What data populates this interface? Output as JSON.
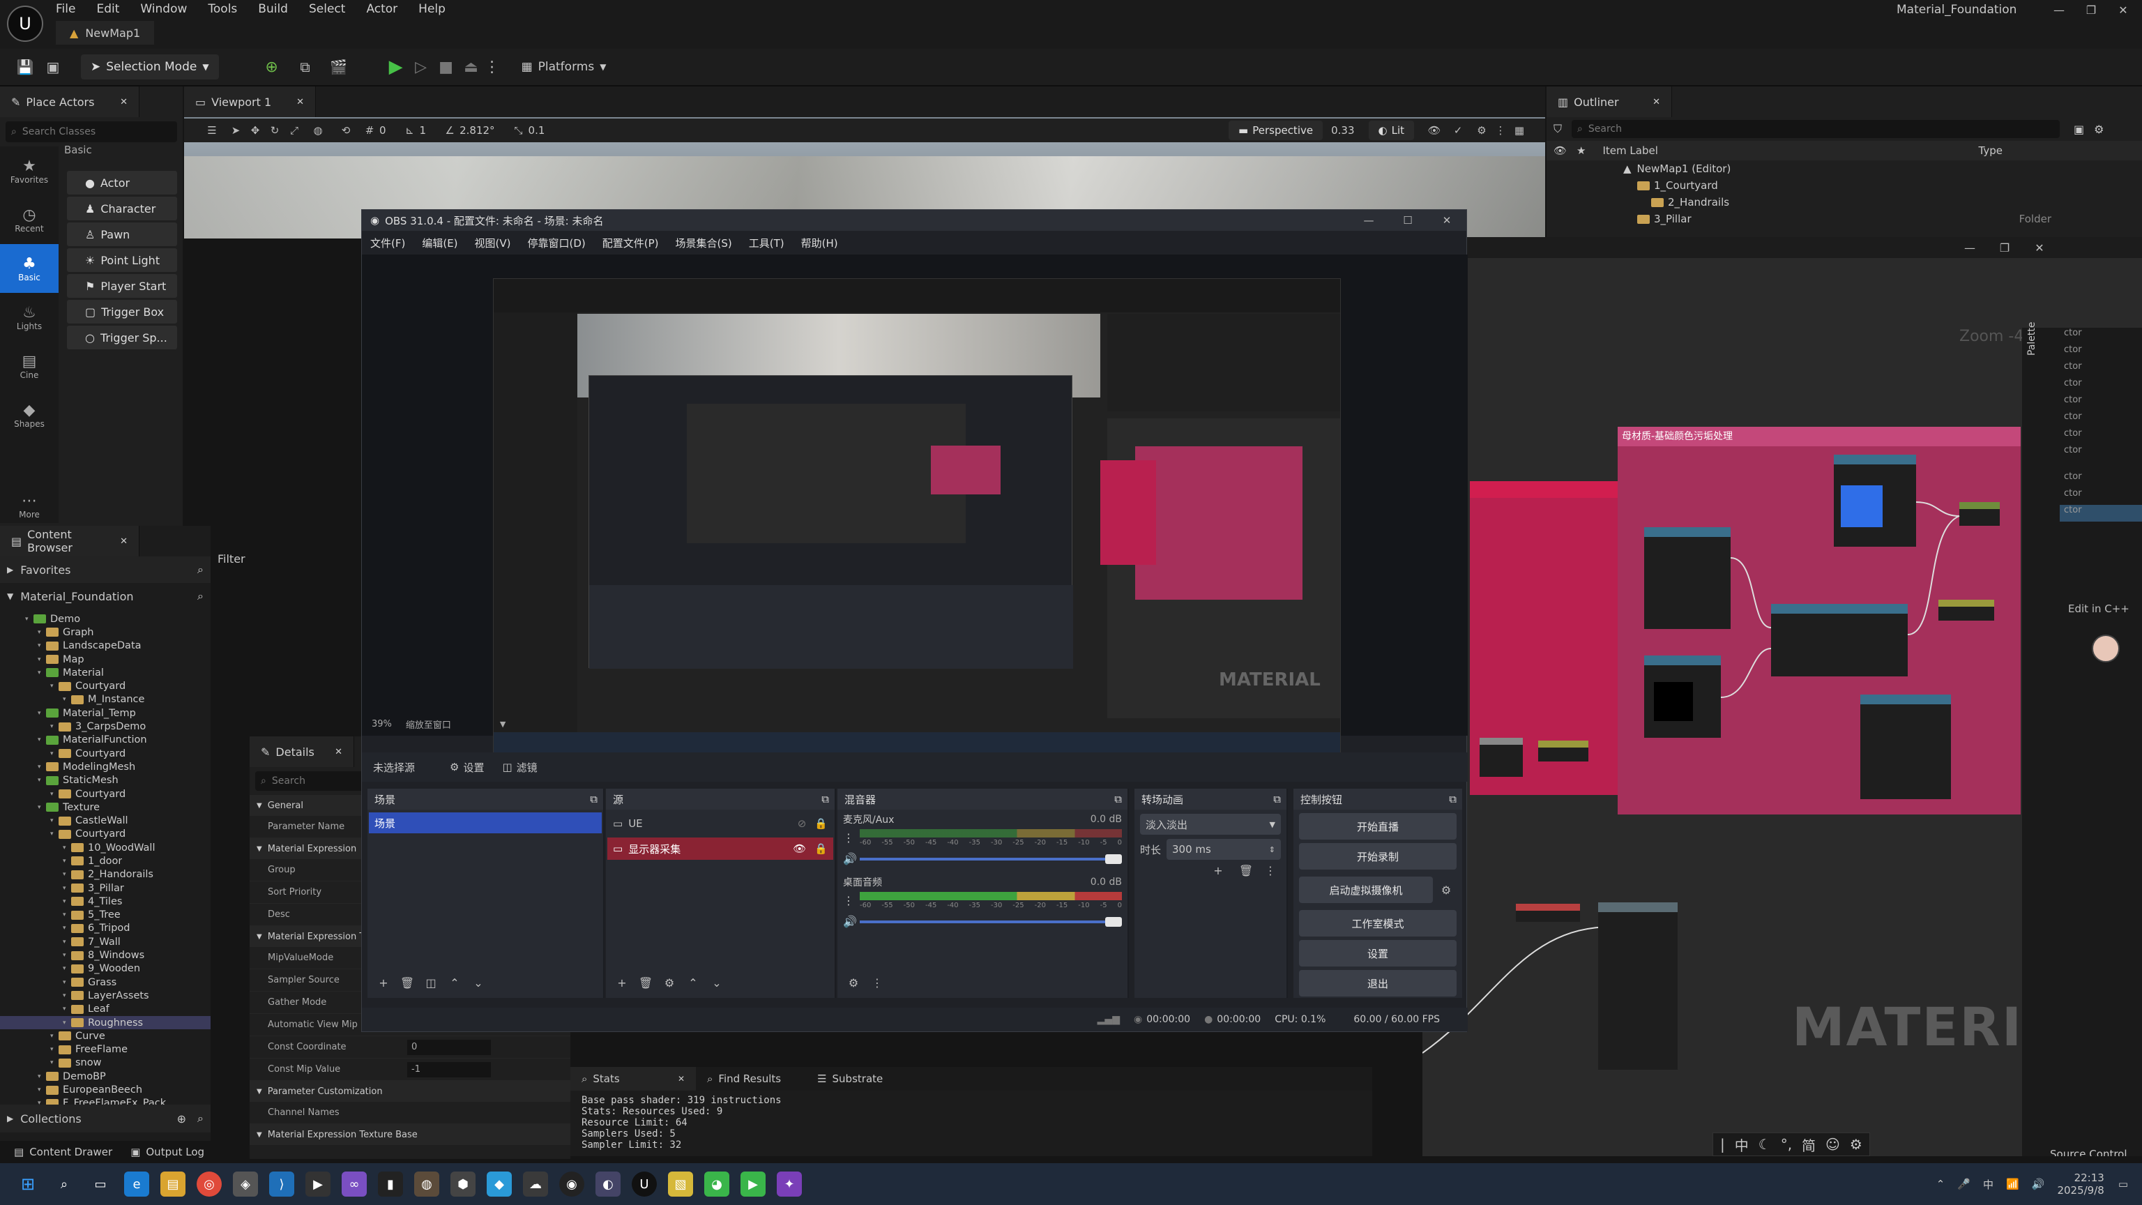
{
  "ue": {
    "menu": [
      "File",
      "Edit",
      "Window",
      "Tools",
      "Build",
      "Select",
      "Actor",
      "Help"
    ],
    "project_name": "Material_Foundation",
    "map_tab": "NewMap1",
    "toolbar": {
      "selection_mode": "Selection Mode",
      "platforms": "Platforms"
    },
    "viewport": {
      "tab": "Viewport 1",
      "perspective": "Perspective",
      "lit": "Lit",
      "angle": "2.812°",
      "grid": "0.1",
      "scale": "0.33",
      "rot_num": "0",
      "pos_num": "1"
    }
  },
  "place_actors": {
    "tab": "Place Actors",
    "search_placeholder": "Search Classes",
    "section": "Basic",
    "categories": [
      "Favorites",
      "Recent",
      "Basic",
      "Lights",
      "Cine",
      "Shapes",
      "More"
    ],
    "items": [
      "Actor",
      "Character",
      "Pawn",
      "Point Light",
      "Player Start",
      "Trigger Box",
      "Trigger Sp..."
    ]
  },
  "outliner": {
    "tab": "Outliner",
    "search_placeholder": "Search",
    "col_label": "Item Label",
    "col_type": "Type",
    "rows": [
      "NewMap1 (Editor)",
      "1_Courtyard",
      "2_Handrails",
      "3_Pillar"
    ],
    "type_folder": "Folder"
  },
  "content_browser": {
    "tab": "Content Browser",
    "favorites": "Favorites",
    "root": "Material_Foundation",
    "filter": "Filter",
    "tree": [
      {
        "label": "Demo",
        "depth": 1,
        "green": true
      },
      {
        "label": "Graph",
        "depth": 2
      },
      {
        "label": "LandscapeData",
        "depth": 2
      },
      {
        "label": "Map",
        "depth": 2
      },
      {
        "label": "Material",
        "depth": 2,
        "green": true
      },
      {
        "label": "Courtyard",
        "depth": 3
      },
      {
        "label": "M_Instance",
        "depth": 4
      },
      {
        "label": "Material_Temp",
        "depth": 2,
        "green": true
      },
      {
        "label": "3_CarpsDemo",
        "depth": 3
      },
      {
        "label": "MaterialFunction",
        "depth": 2,
        "green": true
      },
      {
        "label": "Courtyard",
        "depth": 3
      },
      {
        "label": "ModelingMesh",
        "depth": 2
      },
      {
        "label": "StaticMesh",
        "depth": 2,
        "green": true
      },
      {
        "label": "Courtyard",
        "depth": 3
      },
      {
        "label": "Texture",
        "depth": 2,
        "green": true
      },
      {
        "label": "CastleWall",
        "depth": 3
      },
      {
        "label": "Courtyard",
        "depth": 3
      },
      {
        "label": "10_WoodWall",
        "depth": 4
      },
      {
        "label": "1_door",
        "depth": 4
      },
      {
        "label": "2_Handorails",
        "depth": 4
      },
      {
        "label": "3_Pillar",
        "depth": 4
      },
      {
        "label": "4_Tiles",
        "depth": 4
      },
      {
        "label": "5_Tree",
        "depth": 4
      },
      {
        "label": "6_Tripod",
        "depth": 4
      },
      {
        "label": "7_Wall",
        "depth": 4
      },
      {
        "label": "8_Windows",
        "depth": 4
      },
      {
        "label": "9_Wooden",
        "depth": 4
      },
      {
        "label": "Grass",
        "depth": 4
      },
      {
        "label": "LayerAssets",
        "depth": 4
      },
      {
        "label": "Leaf",
        "depth": 4
      },
      {
        "label": "Roughness",
        "depth": 4,
        "selected": true
      },
      {
        "label": "Curve",
        "depth": 3
      },
      {
        "label": "FreeFlame",
        "depth": 3
      },
      {
        "label": "snow",
        "depth": 3
      },
      {
        "label": "DemoBP",
        "depth": 2
      },
      {
        "label": "EuropeanBeech",
        "depth": 2
      },
      {
        "label": "F_FreeFlameFx_Pack",
        "depth": 2
      }
    ],
    "collections": "Collections",
    "content_drawer": "Content Drawer",
    "output_log": "Output Log"
  },
  "details": {
    "tab": "Details",
    "search_placeholder": "Search",
    "sections": [
      {
        "title": "General",
        "rows": [
          "Parameter Name"
        ]
      },
      {
        "title": "Material Expression",
        "rows": [
          "Group",
          "Sort Priority",
          "Desc"
        ]
      },
      {
        "title": "Material Expression Tex",
        "rows": [
          "MipValueMode",
          "Sampler Source",
          "Gather Mode",
          "Automatic View Mip Bias",
          "Const Coordinate",
          "Const Mip Value"
        ]
      },
      {
        "title": "Parameter Customization",
        "rows": [
          "Channel Names"
        ]
      },
      {
        "title": "Material Expression Texture Base",
        "rows": []
      }
    ],
    "const_coordinate_value": "0",
    "const_mip_value": "-1"
  },
  "bottom_tabs": {
    "stats": "Stats",
    "find_results": "Find Results",
    "substrate": "Substrate"
  },
  "stats_lines": [
    "Base pass shader: 319 instructions",
    "Stats: Resources Used: 9",
    "Resource Limit: 64",
    "Samplers Used: 5",
    "Sampler Limit: 32"
  ],
  "material_editor": {
    "comment_title": "母材质-基础颜色污垢处理",
    "watermark": "MATERIAL",
    "zoom": "Zoom -4",
    "palette": "Palette",
    "edit_cpp": "Edit in C++",
    "source_control": "Source Control",
    "right_rows": [
      "ctor",
      "ctor",
      "ctor",
      "ctor",
      "ctor",
      "ctor",
      "ctor",
      "ctor",
      "ctor",
      "ctor",
      "ctor"
    ]
  },
  "obs": {
    "title": "OBS 31.0.4 - 配置文件: 未命名 - 场景: 未命名",
    "menu": [
      "文件(F)",
      "编辑(E)",
      "视图(V)",
      "停靠窗口(D)",
      "配置文件(P)",
      "场景集合(S)",
      "工具(T)",
      "帮助(H)"
    ],
    "zoom": "39%",
    "zoom_label": "缩放至窗口",
    "no_source": "未选择源",
    "settings_btn": "设置",
    "filters_btn": "滤镜",
    "scenes": {
      "title": "场景",
      "items": [
        "场景"
      ]
    },
    "sources": {
      "title": "源",
      "items": [
        "UE",
        "显示器采集"
      ]
    },
    "mixer": {
      "title": "混音器",
      "channels": [
        {
          "name": "麦克风/Aux",
          "db": "0.0 dB"
        },
        {
          "name": "桌面音频",
          "db": "0.0 dB"
        }
      ],
      "scale": [
        "-60",
        "-55",
        "-50",
        "-45",
        "-40",
        "-35",
        "-30",
        "-25",
        "-20",
        "-15",
        "-10",
        "-5",
        "0"
      ]
    },
    "transitions": {
      "title": "转场动画",
      "type": "淡入淡出",
      "duration_label": "时长",
      "duration": "300 ms"
    },
    "controls": {
      "title": "控制按钮",
      "buttons": [
        "开始直播",
        "开始录制",
        "启动虚拟摄像机",
        "工作室模式",
        "设置",
        "退出"
      ]
    },
    "status": {
      "live_time": "00:00:00",
      "rec_time": "00:00:00",
      "cpu": "CPU: 0.1%",
      "fps": "60.00 / 60.00 FPS"
    },
    "inner_watermark": "MATERIAL"
  },
  "taskbar": {
    "time": "22:13",
    "date": "2025/9/8",
    "ime": [
      "中",
      "简"
    ]
  },
  "colors": {
    "ue_accent": "#1a6bd0",
    "graph_comment": "#c23a6b",
    "obs_scene_selected": "#2f4fb8",
    "obs_source_selected": "#8a2333"
  }
}
